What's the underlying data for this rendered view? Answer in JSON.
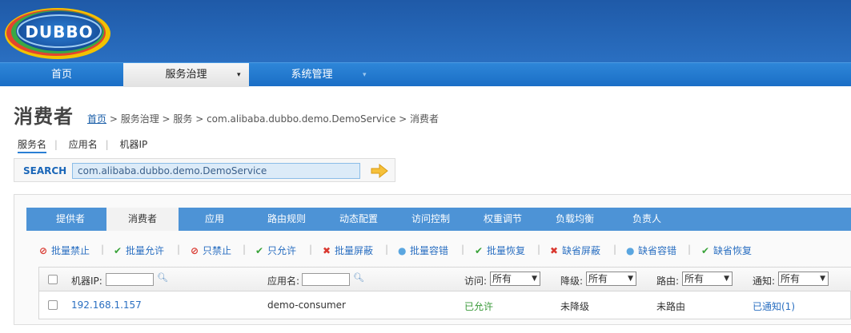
{
  "header": {
    "logo_text": "DUBBO"
  },
  "mainnav": [
    {
      "label": "首页"
    },
    {
      "label": "服务治理",
      "caret": "▾"
    },
    {
      "label": "系统管理",
      "caret": "▾"
    }
  ],
  "page": {
    "title": "消费者",
    "breadcrumb": {
      "home": "首页",
      "rest": " > 服务治理 > 服务 > com.alibaba.dubbo.demo.DemoService > 消费者"
    }
  },
  "search": {
    "tabs": [
      "服务名",
      "应用名",
      "机器IP"
    ],
    "sep": "|",
    "label": "SEARCH",
    "value": "com.alibaba.dubbo.demo.DemoService"
  },
  "tabs": [
    "提供者",
    "消费者",
    "应用",
    "路由规则",
    "动态配置",
    "访问控制",
    "权重调节",
    "负载均衡",
    "负责人"
  ],
  "actions": [
    {
      "label": "批量禁止",
      "icon": "⊘",
      "tone": "red"
    },
    {
      "label": "批量允许",
      "icon": "✔",
      "tone": "green"
    },
    {
      "label": "只禁止",
      "icon": "⊘",
      "tone": "red"
    },
    {
      "label": "只允许",
      "icon": "✔",
      "tone": "green"
    },
    {
      "label": "批量屏蔽",
      "icon": "✖",
      "tone": "red"
    },
    {
      "label": "批量容错",
      "icon": "●",
      "tone": "blue"
    },
    {
      "label": "批量恢复",
      "icon": "✔",
      "tone": "green"
    },
    {
      "label": "缺省屏蔽",
      "icon": "✖",
      "tone": "red"
    },
    {
      "label": "缺省容错",
      "icon": "●",
      "tone": "blue"
    },
    {
      "label": "缺省恢复",
      "icon": "✔",
      "tone": "green"
    }
  ],
  "table": {
    "headers": {
      "ip": "机器IP:",
      "app": "应用名:",
      "access": "访问:",
      "degrade": "降级:",
      "route": "路由:",
      "notify": "通知:"
    },
    "filter_value": "所有",
    "rows": [
      {
        "ip": "192.168.1.157",
        "app": "demo-consumer",
        "access": "已允许",
        "degrade": "未降级",
        "route": "未路由",
        "notify": "已通知(1)"
      }
    ]
  },
  "colors": {
    "header": "#2a6fc1",
    "nav": "#1a6ec6",
    "tabs": "#4d93d6",
    "link": "#2a6fc1",
    "ok": "#3a9a3a",
    "danger": "#d9382f"
  }
}
